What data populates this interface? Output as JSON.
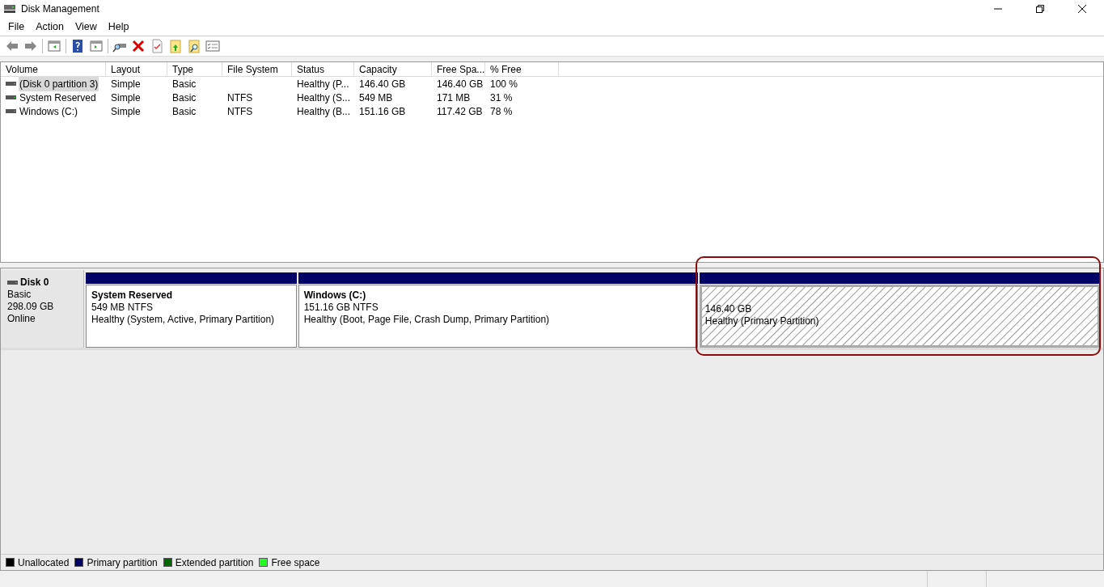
{
  "window": {
    "title": "Disk Management"
  },
  "menu": [
    "File",
    "Action",
    "View",
    "Help"
  ],
  "table": {
    "columns": [
      "Volume",
      "Layout",
      "Type",
      "File System",
      "Status",
      "Capacity",
      "Free Spa...",
      "% Free"
    ],
    "rows": [
      {
        "selected": true,
        "cells": [
          "(Disk 0 partition 3)",
          "Simple",
          "Basic",
          "",
          "Healthy (P...",
          "146.40 GB",
          "146.40 GB",
          "100 %"
        ]
      },
      {
        "selected": false,
        "cells": [
          "System Reserved",
          "Simple",
          "Basic",
          "NTFS",
          "Healthy (S...",
          "549 MB",
          "171 MB",
          "31 %"
        ]
      },
      {
        "selected": false,
        "cells": [
          "Windows (C:)",
          "Simple",
          "Basic",
          "NTFS",
          "Healthy (B...",
          "151.16 GB",
          "117.42 GB",
          "78 %"
        ]
      }
    ]
  },
  "disk": {
    "name": "Disk 0",
    "type": "Basic",
    "size": "298.09 GB",
    "status": "Online",
    "partitions": [
      {
        "selected": false,
        "name": "System Reserved",
        "size": "549 MB NTFS",
        "status": "Healthy (System, Active, Primary Partition)"
      },
      {
        "selected": false,
        "name": "Windows  (C:)",
        "size": "151.16 GB NTFS",
        "status": "Healthy (Boot, Page File, Crash Dump, Primary Partition)"
      },
      {
        "selected": true,
        "size": "146.40 GB",
        "status": "Healthy (Primary Partition)"
      }
    ]
  },
  "legend": [
    {
      "label": "Unallocated",
      "color": "#000000"
    },
    {
      "label": "Primary partition",
      "color": "#000066"
    },
    {
      "label": "Extended partition",
      "color": "#006600"
    },
    {
      "label": "Free space",
      "color": "#22ff22"
    }
  ]
}
